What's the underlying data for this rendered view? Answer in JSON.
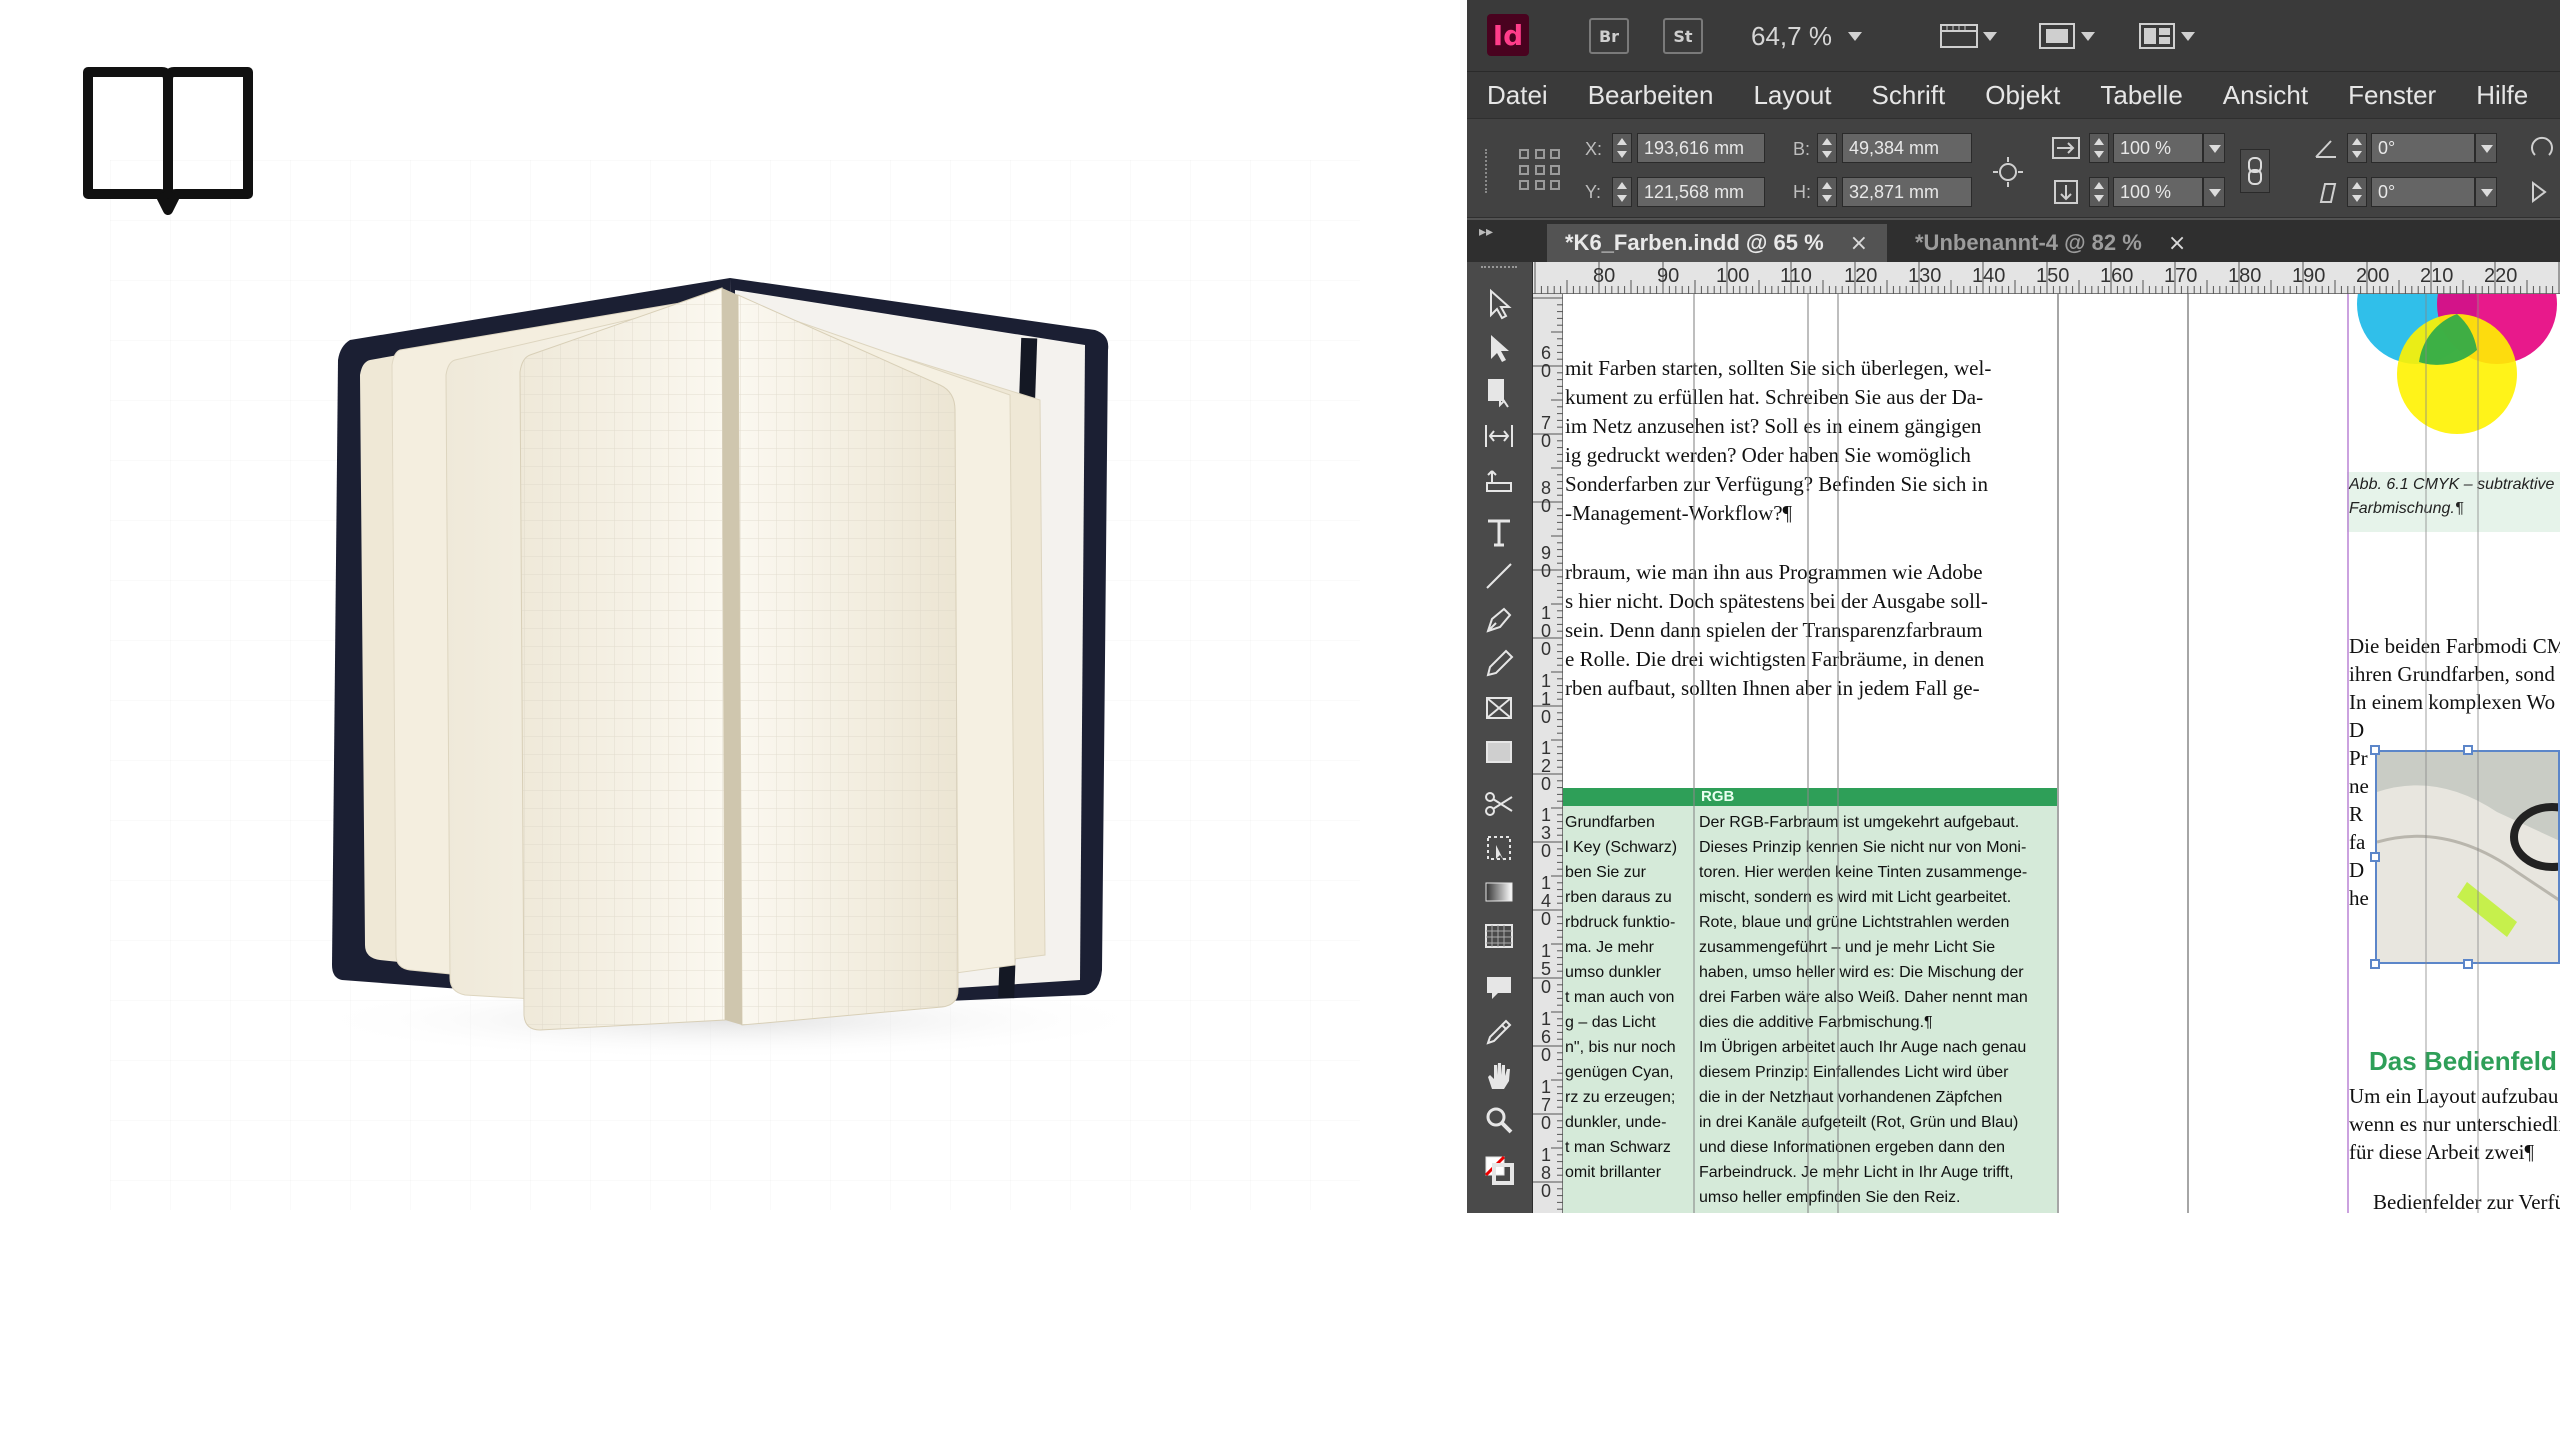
{
  "app": {
    "logo_text": "Id",
    "bridge_label": "Br",
    "stock_label": "St",
    "zoom_level": "64,7 %",
    "accent_color": "#ff3d8a"
  },
  "menu": [
    "Datei",
    "Bearbeiten",
    "Layout",
    "Schrift",
    "Objekt",
    "Tabelle",
    "Ansicht",
    "Fenster",
    "Hilfe"
  ],
  "control": {
    "x_label": "X:",
    "x_value": "193,616 mm",
    "y_label": "Y:",
    "y_value": "121,568 mm",
    "w_label": "B:",
    "w_value": "49,384 mm",
    "h_label": "H:",
    "h_value": "32,871 mm",
    "scale_x": "100 %",
    "scale_y": "100 %",
    "rotation": "0°",
    "shear": "0°"
  },
  "tabs": [
    {
      "label": "*K6_Farben.indd @ 65 %",
      "active": true
    },
    {
      "label": "*Unbenannt-4 @ 82 %",
      "active": false
    }
  ],
  "ruler": {
    "h_numbers": [
      "80",
      "90",
      "100",
      "110",
      "120",
      "130",
      "140",
      "150",
      "160",
      "170",
      "180",
      "190",
      "200",
      "210",
      "220"
    ],
    "v_numbers": [
      "6\n0",
      "7\n0",
      "8\n0",
      "9\n0",
      "1\n0\n0",
      "1\n1\n0",
      "1\n2\n0",
      "1\n3\n0",
      "1\n4\n0",
      "1\n5\n0",
      "1\n6\n0",
      "1\n7\n0",
      "1\n8\n0"
    ]
  },
  "document": {
    "body_lines": [
      "mit Farben starten, sollten Sie sich überlegen, wel-",
      "kument zu erfüllen hat. Schreiben Sie aus der Da-",
      "im Netz anzusehen ist? Soll es in einem gängigen",
      "ig gedruckt werden? Oder haben Sie womöglich",
      "Sonderfarben zur Verfügung? Befinden Sie sich in",
      "-Management-Workflow?¶",
      "rbraum, wie man ihn aus Programmen wie Adobe",
      "s hier nicht. Doch spätestens bei der Ausgabe soll-",
      "sein. Denn dann spielen der Transparenzfarbraum",
      "e Rolle. Die drei wichtigsten Farbräume, in denen",
      "rben aufbaut, sollten Ihnen aber in jedem Fall ge-"
    ],
    "table_header_right": "RGB",
    "table_left": [
      "Grundfarben",
      "l Key (Schwarz)",
      "ben Sie zur",
      "rben daraus zu",
      "rbdruck funktio-",
      "ma. Je mehr",
      "umso dunkler",
      "t man auch von",
      "g – das Licht",
      "n\", bis nur noch",
      "genügen Cyan,",
      "rz zu erzeugen;",
      "dunkler, unde-",
      "t man Schwarz",
      "omit brillanter"
    ],
    "table_right": [
      "Der RGB-Farbraum ist umgekehrt aufgebaut.",
      "Dieses Prinzip kennen Sie nicht nur von Moni-",
      "toren. Hier werden keine Tinten zusammenge-",
      "mischt, sondern es wird mit Licht gearbeitet.",
      "Rote, blaue und grüne Lichtstrahlen werden",
      "zusammengeführt – und je mehr Licht Sie",
      "haben, umso heller wird es: Die Mischung der",
      "drei Farben wäre also Weiß. Daher nennt man",
      "dies die additive Farbmischung.¶",
      "Im Übrigen arbeitet auch Ihr Auge nach genau",
      "diesem Prinzip: Einfallendes Licht wird über",
      "die in der Netzhaut vorhandenen Zäpfchen",
      "in drei Kanäle aufgeteilt (Rot, Grün und Blau)",
      "und diese Informationen ergeben dann den",
      "Farbeindruck. Je mehr Licht in Ihr Auge trifft,",
      "umso heller empfinden Sie den Reiz."
    ],
    "caption_line1": "Abb. 6.1  CMYK – subtraktive",
    "caption_line2": "Farbmischung.¶",
    "right_lines": [
      "Die beiden Farbmodi CM",
      "ihren Grundfarben, sond",
      "In einem komplexen Wo",
      "D",
      "Pr",
      "ne",
      "R",
      "fa",
      "D",
      "he"
    ],
    "heading": "Das Bedienfeld F",
    "right_lines2": [
      "Um ein Layout aufzubau",
      "wenn es nur unterschiedli",
      "für diese Arbeit zwei¶",
      "Bedienfelder zur Verfü"
    ],
    "colors": {
      "green": "#2e9f58",
      "table_bg": "#d5ead9",
      "cyan": "#19b8e8",
      "magenta": "#e6007e",
      "yellow": "#fff200"
    }
  }
}
